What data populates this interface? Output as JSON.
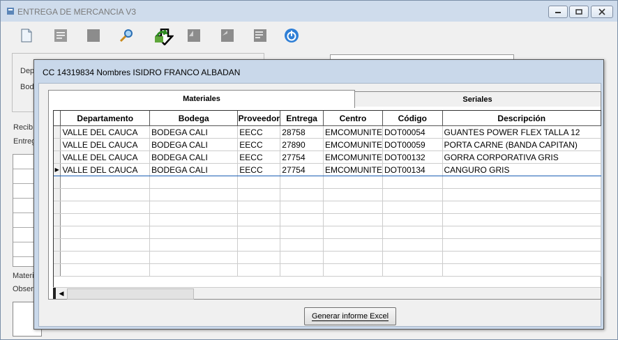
{
  "window": {
    "title": "ENTREGA DE MERCANCIA V3"
  },
  "toolbar": {
    "icons": [
      "new-document-icon",
      "list-document-icon",
      "blank-square-icon",
      "search-magnifier-icon",
      "green-export-arrow-icon",
      "disabled-corner-icon",
      "disabled-corner-icon-2",
      "disabled-list-icon",
      "power-icon"
    ]
  },
  "background_form": {
    "labels": {
      "dep": "Dep",
      "bod": "Bod",
      "recib": "Recib",
      "entreg": "Entreg",
      "materi": "Materi",
      "obser": "Obser"
    }
  },
  "modal": {
    "title": "CC 14319834 Nombres ISIDRO FRANCO ALBADAN",
    "tabs": [
      "Materiales",
      "Seriales"
    ],
    "columns": [
      "Departamento",
      "Bodega",
      "Proveedor",
      "Entrega",
      "Centro",
      "Código",
      "Descripción"
    ],
    "rows": [
      [
        "VALLE DEL CAUCA",
        "BODEGA CALI",
        "EECC",
        "28758",
        "EMCOMUNITE",
        "DOT00054",
        "GUANTES POWER FLEX TALLA 12"
      ],
      [
        "VALLE DEL CAUCA",
        "BODEGA CALI",
        "EECC",
        "27890",
        "EMCOMUNITE",
        "DOT00059",
        "PORTA CARNE (BANDA CAPITAN)"
      ],
      [
        "VALLE DEL CAUCA",
        "BODEGA CALI",
        "EECC",
        "27754",
        "EMCOMUNITE",
        "DOT00132",
        "GORRA CORPORATIVA GRIS"
      ],
      [
        "VALLE DEL CAUCA",
        "BODEGA CALI",
        "EECC",
        "27754",
        "EMCOMUNITE",
        "DOT00134",
        "CANGURO GRIS"
      ]
    ],
    "current_row": 3,
    "excel_button": "Generar informe Excel"
  }
}
